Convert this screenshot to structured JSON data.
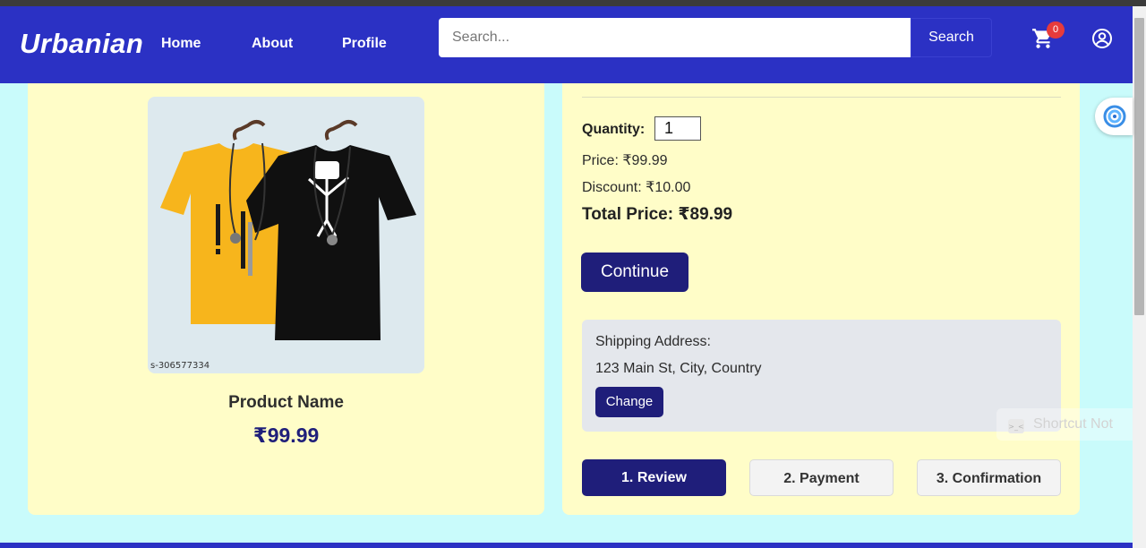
{
  "navbar": {
    "brand": "Urbanian",
    "links": [
      "Home",
      "About",
      "Profile"
    ],
    "search_placeholder": "Search...",
    "search_button": "Search",
    "cart_count": "0",
    "bg_color": "#2b31c4"
  },
  "product": {
    "image_code": "s-306577334",
    "name": "Product Name",
    "price": "₹99.99"
  },
  "checkout": {
    "quantity_label": "Quantity:",
    "quantity_value": "1",
    "price_line": "Price: ₹99.99",
    "discount_line": "Discount: ₹10.00",
    "total_line": "Total Price: ₹89.99",
    "continue_label": "Continue",
    "shipping_label": "Shipping Address:",
    "shipping_address": "123 Main St, City, Country",
    "change_label": "Change",
    "steps": [
      "1. Review",
      "2. Payment",
      "3. Confirmation"
    ],
    "active_step": "1. Review",
    "accent_color": "#1f1e7a"
  },
  "overlay": {
    "shortcut_text": "Shortcut Not"
  }
}
